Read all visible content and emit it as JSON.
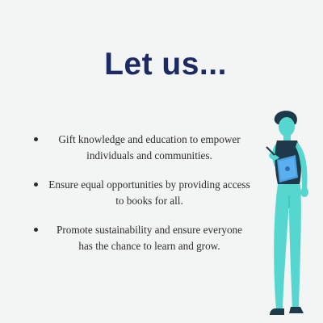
{
  "title": "Let us...",
  "points": [
    "Gift knowledge and education to empower individuals and communities.",
    "Ensure equal opportunities by providing access to books for all.",
    "Promote sustainability and ensure everyone has the chance to learn and grow."
  ],
  "colors": {
    "background": "#f3f4f4",
    "title": "#1c2a63",
    "body_text": "#2d2d2d",
    "figure_teal": "#55d6cf",
    "figure_dark": "#1e3a4a"
  },
  "illustration": {
    "icon": "person-reading-tablet-icon"
  }
}
